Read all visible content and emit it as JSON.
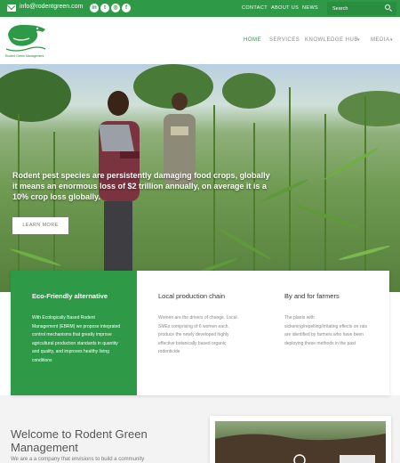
{
  "topbar": {
    "email": "info@rodentgreen.com",
    "social": [
      {
        "icon": "linkedin-icon",
        "glyph": "in"
      },
      {
        "icon": "twitter-icon",
        "glyph": "t"
      },
      {
        "icon": "instagram-icon",
        "glyph": "◎"
      },
      {
        "icon": "facebook-icon",
        "glyph": "f"
      }
    ],
    "nav": [
      "CONTACT",
      "ABOUT US",
      "NEWS"
    ],
    "search_placeholder": "Search"
  },
  "header": {
    "logo_text": "Rodent Green Management",
    "nav": [
      "HOME",
      "SERVICES",
      "KNOWLEDGE HUB",
      "MEDIA"
    ]
  },
  "hero": {
    "headline": "Rodent pest species are persistently damaging food crops, globally it means an enormous loss of $2 trillion annually, on average it is a 10% crop loss globally.",
    "button": "LEARN MORE"
  },
  "features": [
    {
      "title": "Eco-Friendly alternative",
      "text": "With Ecologically Based Rodent Management (EBRM) we propose integrated control mechanisms that greatly improve agricultural production standards in quantity and quality, and improves healthy living conditions"
    },
    {
      "title": "Local production chain",
      "text": "Women are the drivers of change. Local SMEs comprising of 6 women each, produce the newly developed highly effective botanically based organic rodenticide"
    },
    {
      "title": "By and for farmers",
      "text": "The plants with sickening/repelling/irritating effects on rats are identified by farmers who have been deploying these methods in the past"
    }
  ],
  "welcome": {
    "title": "Welcome to Rodent Green Management",
    "subtitle": "We are a a company that envisions to build a community"
  },
  "colors": {
    "brand_green": "#2e9946"
  }
}
